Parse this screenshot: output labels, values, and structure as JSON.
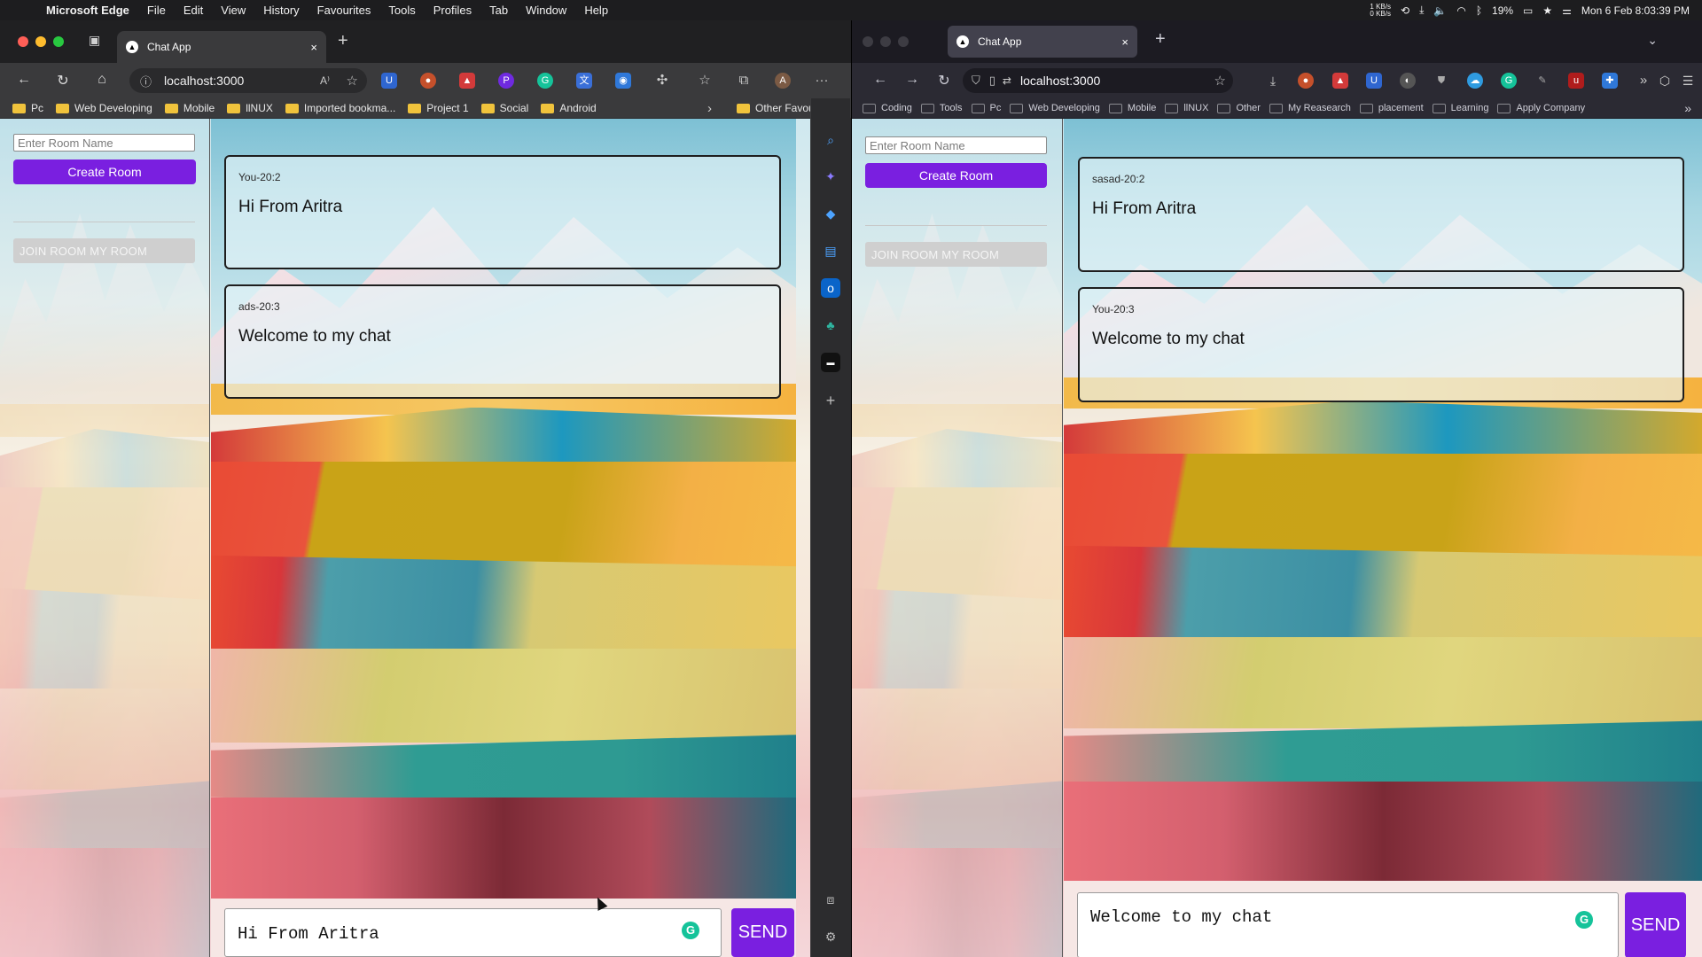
{
  "menubar": {
    "apple": "",
    "app": "Microsoft Edge",
    "items": [
      "File",
      "Edit",
      "View",
      "History",
      "Favourites",
      "Tools",
      "Profiles",
      "Tab",
      "Window",
      "Help"
    ],
    "net_up": "1 KB/s",
    "net_down": "0 KB/s",
    "battery": "19%",
    "datetime": "Mon 6 Feb  8:03:39 PM"
  },
  "left_window": {
    "tab_title": "Chat App",
    "url": "localhost:3000",
    "bookmarks": [
      "Pc",
      "Web Developing",
      "Mobile",
      "llNUX",
      "Imported bookma...",
      "Project 1",
      "Social",
      "Android"
    ],
    "other_favourites": "Other Favourites",
    "room_placeholder": "Enter Room Name",
    "create_room": "Create Room",
    "join_room": "JOIN ROOM MY ROOM",
    "messages": [
      {
        "meta": "You-20:2",
        "text": "Hi From Aritra"
      },
      {
        "meta": "ads-20:3",
        "text": "Welcome to my chat"
      }
    ],
    "composer_value": "Hi From Aritra",
    "send": "SEND"
  },
  "right_window": {
    "tab_title": "Chat App",
    "url": "localhost:3000",
    "bookmarks": [
      "Coding",
      "Tools",
      "Pc",
      "Web Developing",
      "Mobile",
      "llNUX",
      "Other",
      "My Reasearch",
      "placement",
      "Learning",
      "Apply Company"
    ],
    "room_placeholder": "Enter Room Name",
    "create_room": "Create Room",
    "join_room": "JOIN ROOM MY ROOM",
    "messages": [
      {
        "meta": "sasad-20:2",
        "text": "Hi From Aritra"
      },
      {
        "meta": "You-20:3",
        "text": "Welcome to my chat"
      }
    ],
    "composer_value": "Welcome to my chat",
    "send": "SEND"
  },
  "icons": {
    "close": "×",
    "plus": "+",
    "back": "←",
    "forward": "→",
    "reload": "↻",
    "home": "⌂",
    "star": "☆",
    "more": "···",
    "chevron": "›",
    "double_chevron": "»",
    "grammarly": "G"
  },
  "colors": {
    "accent": "#7a1fe0",
    "join_bg": "#cfcfcf",
    "grammarly": "#15c39a"
  }
}
